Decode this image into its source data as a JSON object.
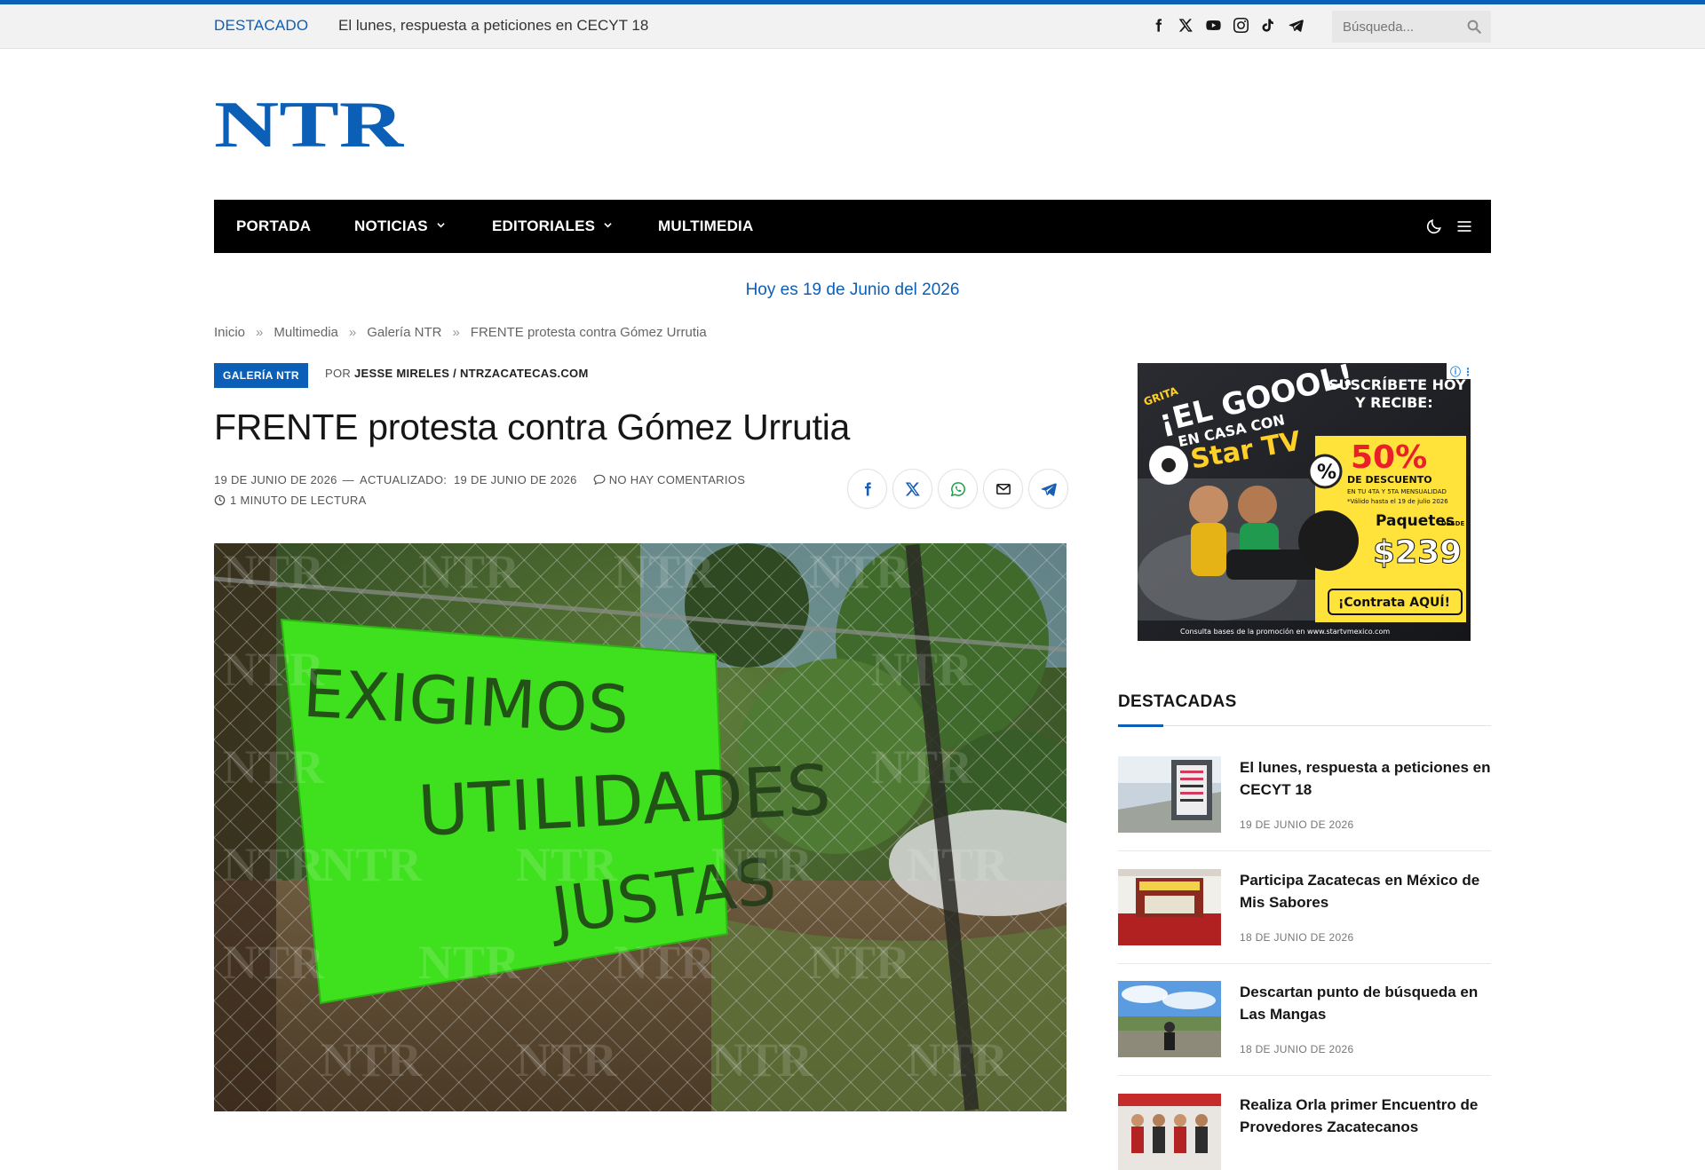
{
  "topbar": {
    "trending_label": "DESTACADO",
    "trending_text": "El lunes, respuesta a peticiones en CECYT 18",
    "socials": [
      "facebook-icon",
      "x-icon",
      "youtube-icon",
      "instagram-icon",
      "tiktok-icon",
      "telegram-icon"
    ],
    "search_placeholder": "Búsqueda..."
  },
  "logo": {
    "text": "NTR",
    "color": "#0b5fb6"
  },
  "nav": {
    "items": [
      {
        "label": "PORTADA",
        "dropdown": false
      },
      {
        "label": "NOTICIAS",
        "dropdown": true
      },
      {
        "label": "EDITORIALES",
        "dropdown": true
      },
      {
        "label": "MULTIMEDIA",
        "dropdown": false
      }
    ]
  },
  "today": "Hoy es 19 de Junio del 2026",
  "breadcrumb": [
    "Inicio",
    "Multimedia",
    "Galería NTR",
    "FRENTE protesta contra Gómez Urrutia"
  ],
  "breadcrumb_sep": "»",
  "article": {
    "category": "GALERÍA NTR",
    "by_prefix": "POR",
    "author": "JESSE MIRELES / NTRZACATECAS.COM",
    "title": "FRENTE protesta contra Gómez Urrutia",
    "date": "19 DE JUNIO DE 2026",
    "dash": "—",
    "updated_label": "ACTUALIZADO:",
    "updated": "19 DE JUNIO DE 2026",
    "comments": "NO HAY COMENTARIOS",
    "read_time": "1 MINUTO DE LECTURA",
    "share": [
      "facebook-share",
      "x-share",
      "whatsapp-share",
      "email-share",
      "telegram-share"
    ],
    "image": {
      "sign_lines": [
        "EXIGIMOS",
        "UTILIDADES",
        "JUSTAS"
      ],
      "watermark": "NTR"
    }
  },
  "ad": {
    "left_lines": [
      "GRITA",
      "¡EL GOOOL!",
      "EN CASA CON",
      "Star TV"
    ],
    "right_lines": [
      "SUSCRÍBETE HOY",
      "Y RECIBE:"
    ],
    "percent": "50%",
    "discount": "DE DESCUENTO",
    "discount_sub": "EN TU 4TA Y 5TA MENSUALIDAD",
    "valid": "*Válido hasta el 19 de julio 2026",
    "packages": "Paquetes",
    "from": "DESDE",
    "price": "$239",
    "cta": "¡Contrata AQUÍ!",
    "footer": "Consulta bases de la promoción en www.startvmexico.com"
  },
  "sidebar": {
    "title": "DESTACADAS",
    "posts": [
      {
        "title": "El lunes, respuesta a peticiones en CECYT 18",
        "date": "19 DE JUNIO DE 2026"
      },
      {
        "title": "Participa Zacatecas en México de Mis Sabores",
        "date": "18 DE JUNIO DE 2026"
      },
      {
        "title": "Descartan punto de búsqueda en Las Mangas",
        "date": "18 DE JUNIO DE 2026"
      },
      {
        "title": "Realiza Orla primer Encuentro de Provedores Zacatecanos",
        "date": ""
      }
    ]
  },
  "colors": {
    "accent": "#0b5fb6",
    "nav_bg": "#000000",
    "topbar_bg": "#f2f2f2"
  }
}
